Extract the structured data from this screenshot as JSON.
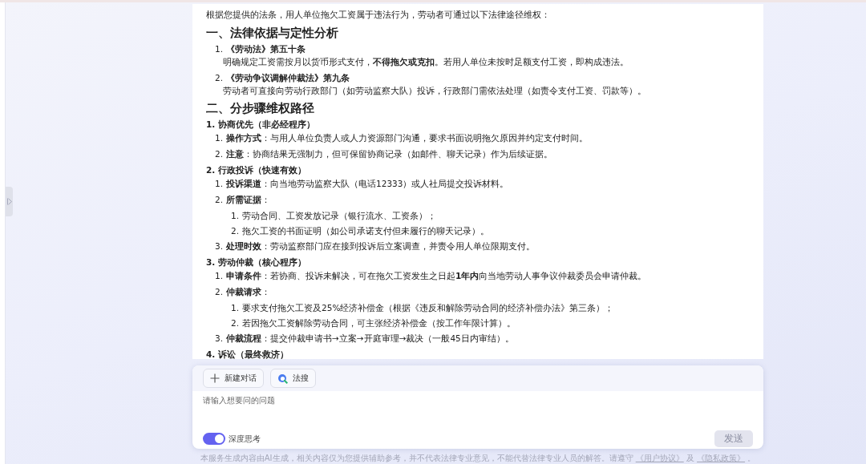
{
  "answer": [
    {
      "kind": "intro",
      "text": "根据您提供的法条，用人单位拖欠工资属于违法行为，劳动者可通过以下法律途径维权："
    },
    {
      "kind": "heading",
      "text": "一、法律依据与定性分析"
    },
    {
      "kind": "item",
      "num": "1.",
      "text": "《劳动法》第五十条",
      "body": "明确规定工资需按月以货币形式支付，**不得拖欠或克扣**。若用人单位未按时足额支付工资，即构成违法。"
    },
    {
      "kind": "item",
      "num": "2.",
      "text": "《劳动争议调解仲裁法》第九条",
      "body": "劳动者可直接向劳动行政部门（如劳动监察大队）投诉，行政部门需依法处理（如责令支付工资、罚款等）。"
    },
    {
      "kind": "heading",
      "text": "二、分步骤维权路径"
    },
    {
      "kind": "step",
      "num": "1.",
      "text": "协商优先（非必经程序）"
    },
    {
      "kind": "sub",
      "num": "1.",
      "text": "**操作方式**：与用人单位负责人或人力资源部门沟通，要求书面说明拖欠原因并约定支付时间。"
    },
    {
      "kind": "sub",
      "num": "2.",
      "text": "**注意**：协商结果无强制力，但可保留协商记录（如邮件、聊天记录）作为后续证据。"
    },
    {
      "kind": "step",
      "num": "2.",
      "text": "行政投诉（快速有效）"
    },
    {
      "kind": "sub",
      "num": "1.",
      "text": "**投诉渠道**：向当地劳动监察大队（电话12333）或人社局提交投诉材料。"
    },
    {
      "kind": "sub",
      "num": "2.",
      "text": "**所需证据**："
    },
    {
      "kind": "subsub",
      "num": "1.",
      "text": "劳动合同、工资发放记录（银行流水、工资条）；"
    },
    {
      "kind": "subsub",
      "num": "2.",
      "text": "拖欠工资的书面证明（如公司承诺支付但未履行的聊天记录）。"
    },
    {
      "kind": "sub",
      "num": "3.",
      "text": "**处理时效**：劳动监察部门应在接到投诉后立案调查，并责令用人单位限期支付。"
    },
    {
      "kind": "step",
      "num": "3.",
      "text": "劳动仲裁（核心程序）"
    },
    {
      "kind": "sub",
      "num": "1.",
      "text": "**申请条件**：若协商、投诉未解决，可在拖欠工资发生之日起**1年内**向当地劳动人事争议仲裁委员会申请仲裁。"
    },
    {
      "kind": "sub",
      "num": "2.",
      "text": "**仲裁请求**："
    },
    {
      "kind": "subsub",
      "num": "1.",
      "text": "要求支付拖欠工资及25%经济补偿金（根据《违反和解除劳动合同的经济补偿办法》第三条）；"
    },
    {
      "kind": "subsub",
      "num": "2.",
      "text": "若因拖欠工资解除劳动合同，可主张经济补偿金（按工作年限计算）。"
    },
    {
      "kind": "sub",
      "num": "3.",
      "text": "**仲裁流程**：提交仲裁申请书→立案→开庭审理→裁决（一般45日内审结）。"
    },
    {
      "kind": "step",
      "num": "4.",
      "text": "诉讼（最终救济）"
    }
  ],
  "composer": {
    "buttons": [
      {
        "kind": "new",
        "label": "新建对话"
      },
      {
        "kind": "search",
        "label": "法搜"
      }
    ],
    "placeholder": "请输入想要问的问题",
    "deep_think": {
      "label": "深度思考",
      "on": true
    },
    "send": {
      "label": "发送",
      "disabled": true
    }
  },
  "footer": {
    "text": "本服务生成内容由AI生成，相关内容仅为您提供辅助参考，并不代表法律专业意见，不能代替法律专业人员的解答。请遵守",
    "link1": "《用户协议》",
    "mid": "及",
    "link2": "《隐私政策》",
    "end": "。"
  }
}
